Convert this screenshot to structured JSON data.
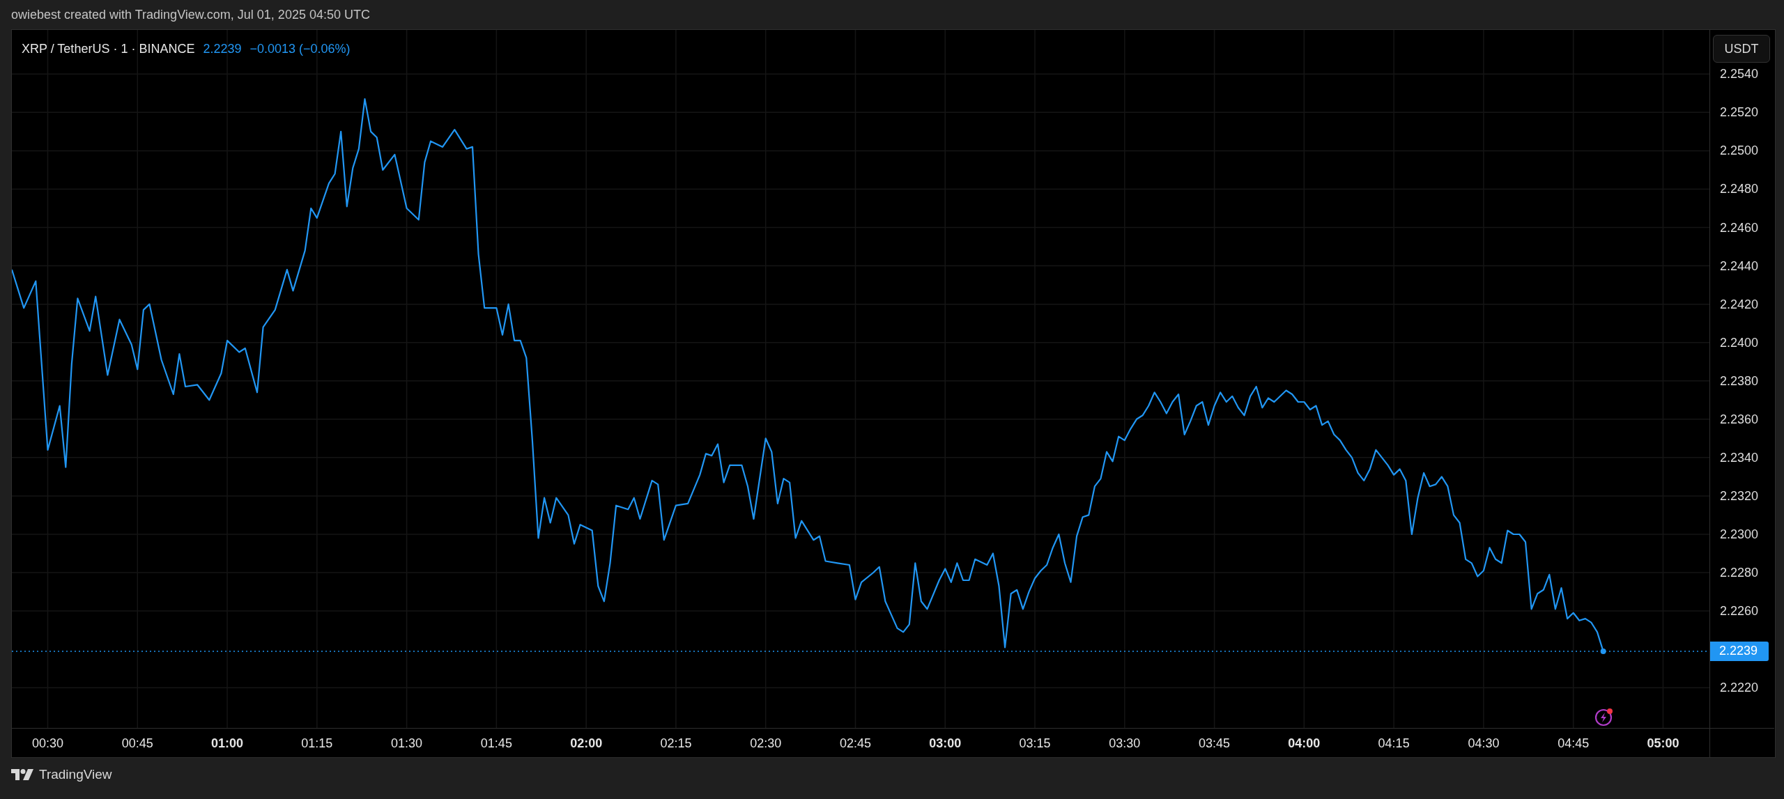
{
  "header": {
    "caption": "owiebest created with TradingView.com, Jul 01, 2025 04:50 UTC"
  },
  "legend": {
    "symbol": "XRP / TetherUS · 1 · BINANCE",
    "price": "2.2239",
    "change": "−0.0013 (−0.06%)"
  },
  "price_scale": {
    "currency": "USDT"
  },
  "chart": {
    "chart_data": {
      "type": "line",
      "x": [
        24,
        26,
        28,
        30,
        32,
        33,
        34,
        35,
        37,
        38,
        40,
        42,
        44,
        45,
        46,
        47,
        49,
        51,
        52,
        53,
        55,
        57,
        59,
        60,
        62,
        63,
        65,
        66,
        68,
        70,
        71,
        73,
        74,
        75,
        77,
        78,
        79,
        80,
        81,
        82,
        83,
        84,
        85,
        86,
        88,
        90,
        92,
        93,
        94,
        96,
        98,
        100,
        101,
        102,
        103,
        105,
        106,
        107,
        108,
        109,
        110,
        111,
        112,
        113,
        114,
        115,
        117,
        118,
        119,
        121,
        122,
        123,
        124,
        125,
        127,
        128,
        129,
        131,
        132,
        133,
        135,
        137,
        139,
        140,
        141,
        142,
        143,
        144,
        146,
        147,
        148,
        150,
        151,
        152,
        153,
        154,
        155,
        156,
        158,
        159,
        160,
        162,
        164,
        165,
        166,
        168,
        169,
        170,
        172,
        173,
        174,
        175,
        176,
        177,
        179,
        180,
        181,
        182,
        183,
        184,
        185,
        187,
        188,
        189,
        190,
        191,
        192,
        193,
        194,
        195,
        196,
        197,
        198,
        199,
        200,
        201,
        202,
        203,
        204,
        205,
        206,
        207,
        208,
        209,
        210,
        211,
        212,
        213,
        214,
        215,
        216,
        217,
        218,
        219,
        220,
        221,
        222,
        223,
        224,
        225,
        226,
        227,
        228,
        229,
        230,
        231,
        232,
        233,
        234,
        235,
        236,
        237,
        238,
        239,
        240,
        241,
        242,
        243,
        244,
        245,
        246,
        247,
        248,
        249,
        250,
        251,
        252,
        253,
        254,
        255,
        256,
        257,
        258,
        259,
        260,
        261,
        262,
        263,
        264,
        265,
        266,
        267,
        268,
        269,
        270,
        271,
        272,
        273,
        274,
        275,
        276,
        277,
        278,
        279,
        280,
        281,
        282,
        283,
        284,
        285,
        286,
        287,
        288,
        289,
        290
      ],
      "series": [
        {
          "color": "#2196f3",
          "values": [
            2.2438,
            2.2418,
            2.2432,
            2.2344,
            2.2367,
            2.2335,
            2.2389,
            2.2423,
            2.2406,
            2.2424,
            2.2383,
            2.2412,
            2.2399,
            2.2386,
            2.2417,
            2.242,
            2.2391,
            2.2373,
            2.2394,
            2.2377,
            2.2378,
            2.237,
            2.2384,
            2.2401,
            2.2395,
            2.2397,
            2.2374,
            2.2408,
            2.2417,
            2.2438,
            2.2427,
            2.2448,
            2.247,
            2.2465,
            2.2483,
            2.2488,
            2.251,
            2.2471,
            2.2491,
            2.2501,
            2.2527,
            2.251,
            2.2507,
            2.249,
            2.2498,
            2.247,
            2.2464,
            2.2494,
            2.2505,
            2.2502,
            2.2511,
            2.2501,
            2.2502,
            2.2446,
            2.2418,
            2.2418,
            2.2404,
            2.242,
            2.2401,
            2.2401,
            2.2392,
            2.2349,
            2.2298,
            2.2319,
            2.2306,
            2.2319,
            2.231,
            2.2295,
            2.2305,
            2.2302,
            2.2273,
            2.2265,
            2.2285,
            2.2315,
            2.2313,
            2.2319,
            2.2308,
            2.2328,
            2.2326,
            2.2297,
            2.2315,
            2.2316,
            2.2331,
            2.2342,
            2.2341,
            2.2347,
            2.2327,
            2.2336,
            2.2336,
            2.2325,
            2.2308,
            2.235,
            2.2343,
            2.2316,
            2.2329,
            2.2327,
            2.2298,
            2.2307,
            2.2297,
            2.2299,
            2.2286,
            2.2285,
            2.2284,
            2.2266,
            2.2275,
            2.228,
            2.2283,
            2.2265,
            2.2251,
            2.2249,
            2.2253,
            2.2285,
            2.2265,
            2.2261,
            2.2276,
            2.2282,
            2.2275,
            2.2285,
            2.2276,
            2.2276,
            2.2287,
            2.2284,
            2.229,
            2.2273,
            2.2241,
            2.2269,
            2.2271,
            2.2261,
            2.227,
            2.2277,
            2.2281,
            2.2284,
            2.2293,
            2.23,
            2.2285,
            2.2275,
            2.2299,
            2.2309,
            2.231,
            2.2325,
            2.2329,
            2.2343,
            2.2338,
            2.2351,
            2.2349,
            2.2355,
            2.236,
            2.2362,
            2.2367,
            2.2374,
            2.2369,
            2.2363,
            2.2369,
            2.2373,
            2.2352,
            2.2359,
            2.2367,
            2.2369,
            2.2357,
            2.2367,
            2.2374,
            2.2369,
            2.2372,
            2.2366,
            2.2362,
            2.2372,
            2.2377,
            2.2366,
            2.2371,
            2.2369,
            2.2372,
            2.2375,
            2.2373,
            2.2369,
            2.2369,
            2.2365,
            2.2367,
            2.2357,
            2.2359,
            2.2352,
            2.2349,
            2.2344,
            2.234,
            2.2332,
            2.2328,
            2.2334,
            2.2344,
            2.234,
            2.2336,
            2.2331,
            2.2334,
            2.2328,
            2.23,
            2.2319,
            2.2332,
            2.2325,
            2.2326,
            2.233,
            2.2325,
            2.231,
            2.2306,
            2.2287,
            2.2285,
            2.2278,
            2.2281,
            2.2293,
            2.2287,
            2.2285,
            2.2302,
            2.23,
            2.23,
            2.2296,
            2.2261,
            2.2269,
            2.2271,
            2.2279,
            2.2261,
            2.2272,
            2.2256,
            2.2259,
            2.2255,
            2.2256,
            2.2254,
            2.2249,
            2.2239
          ]
        }
      ],
      "xlim": [
        24,
        318.7
      ],
      "ylim": [
        2.2199,
        2.2563
      ],
      "xticks": [
        {
          "value": 30,
          "label": "00:30"
        },
        {
          "value": 45,
          "label": "00:45"
        },
        {
          "value": 60,
          "label": "01:00"
        },
        {
          "value": 75,
          "label": "01:15"
        },
        {
          "value": 90,
          "label": "01:30"
        },
        {
          "value": 105,
          "label": "01:45"
        },
        {
          "value": 120,
          "label": "02:00"
        },
        {
          "value": 135,
          "label": "02:15"
        },
        {
          "value": 150,
          "label": "02:30"
        },
        {
          "value": 165,
          "label": "02:45"
        },
        {
          "value": 180,
          "label": "03:00"
        },
        {
          "value": 195,
          "label": "03:15"
        },
        {
          "value": 210,
          "label": "03:30"
        },
        {
          "value": 225,
          "label": "03:45"
        },
        {
          "value": 240,
          "label": "04:00"
        },
        {
          "value": 255,
          "label": "04:15"
        },
        {
          "value": 270,
          "label": "04:30"
        },
        {
          "value": 285,
          "label": "04:45"
        },
        {
          "value": 300,
          "label": "05:00"
        }
      ],
      "yticks": [
        {
          "value": 2.254,
          "label": "2.2540"
        },
        {
          "value": 2.252,
          "label": "2.2520"
        },
        {
          "value": 2.25,
          "label": "2.2500"
        },
        {
          "value": 2.248,
          "label": "2.2480"
        },
        {
          "value": 2.246,
          "label": "2.2460"
        },
        {
          "value": 2.244,
          "label": "2.2440"
        },
        {
          "value": 2.242,
          "label": "2.2420"
        },
        {
          "value": 2.24,
          "label": "2.2400"
        },
        {
          "value": 2.238,
          "label": "2.2380"
        },
        {
          "value": 2.236,
          "label": "2.2360"
        },
        {
          "value": 2.234,
          "label": "2.2340"
        },
        {
          "value": 2.232,
          "label": "2.2320"
        },
        {
          "value": 2.23,
          "label": "2.2300"
        },
        {
          "value": 2.228,
          "label": "2.2280"
        },
        {
          "value": 2.226,
          "label": "2.2260"
        },
        {
          "value": 2.222,
          "label": "2.2220"
        }
      ],
      "grid": true,
      "ref_lines": [
        {
          "axis": "y",
          "value": 2.2239,
          "label": "2.2239",
          "color": "#2196f3"
        }
      ]
    }
  },
  "footer": {
    "brand": "TradingView"
  }
}
